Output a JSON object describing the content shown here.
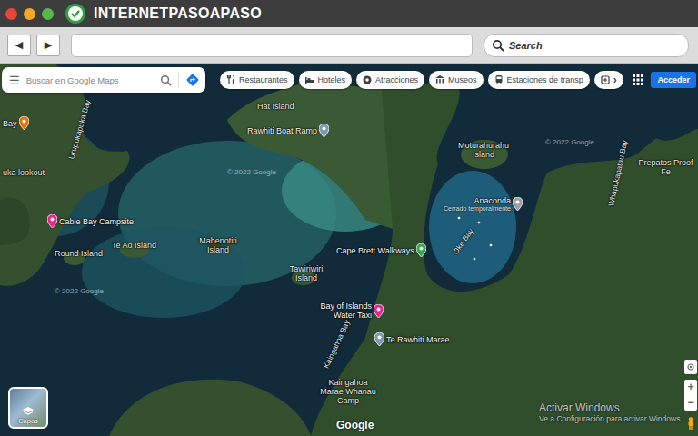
{
  "browser": {
    "logo": "INTERNETPASOAPASO",
    "back": "◀",
    "forward": "▶",
    "search": "Search"
  },
  "maps": {
    "menu": "☰",
    "search_placeholder": "Buscar en Google Maps",
    "chips": [
      {
        "label": "Restaurantes"
      },
      {
        "label": "Hoteles"
      },
      {
        "label": "Atracciones"
      },
      {
        "label": "Museos"
      },
      {
        "label": "Estaciones de transp"
      }
    ],
    "more": "›",
    "sign_in": "Acceder",
    "layers": "Capas",
    "brand": "Google",
    "zoom_in": "+",
    "zoom_out": "−"
  },
  "places": [
    {
      "name": "Bay",
      "kind": "pin",
      "color": "#e8710a"
    },
    {
      "name": "Urupukapuka Bay",
      "kind": "road"
    },
    {
      "name": "uka lookout",
      "kind": "label"
    },
    {
      "name": "Cable Bay Campsite",
      "kind": "pin",
      "color": "#e52592"
    },
    {
      "name": "Te Ao Island",
      "kind": "label"
    },
    {
      "name": "Round Island",
      "kind": "label"
    },
    {
      "name": "Mahenotiti Island",
      "kind": "label"
    },
    {
      "name": "Hat Island",
      "kind": "label"
    },
    {
      "name": "Rawhiti Boat Ramp",
      "kind": "pin",
      "color": "#7b9ab5"
    },
    {
      "name": "Moturahurahu Island",
      "kind": "label"
    },
    {
      "name": "Anaconda",
      "kind": "pin",
      "color": "#9aa0a6",
      "note": "Cerrado temporalmente"
    },
    {
      "name": "Oke Bay",
      "kind": "road"
    },
    {
      "name": "Whapukapatau Bay",
      "kind": "road"
    },
    {
      "name": "Prepatos Proof Fe",
      "kind": "label"
    },
    {
      "name": "Cape Brett Walkways",
      "kind": "pin",
      "color": "#34a853"
    },
    {
      "name": "Tawiriwiri Island",
      "kind": "label"
    },
    {
      "name": "Bay of Islands Water Taxi",
      "kind": "pin",
      "color": "#e52592"
    },
    {
      "name": "Te Rawhiti Marae",
      "kind": "pin",
      "color": "#7b9ab5"
    },
    {
      "name": "Kaingahoa Bay",
      "kind": "road"
    },
    {
      "name": "Kaingahoa Marae Whanau Camp",
      "kind": "label"
    }
  ],
  "watermarks": [
    "© 2022 Google",
    "© 2022 Google",
    "© 2022 Google"
  ],
  "windows_notice": {
    "title": "Activar Windows",
    "text": "Ve a Configuración para activar Windows."
  }
}
